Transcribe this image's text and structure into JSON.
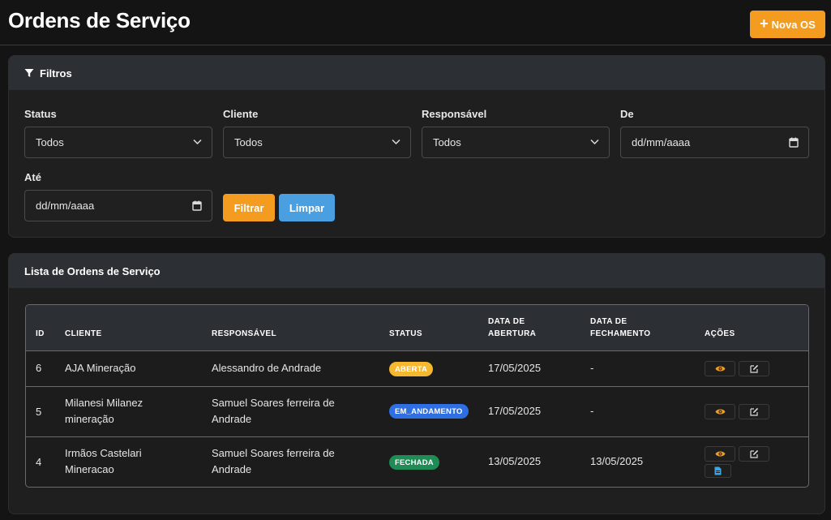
{
  "page": {
    "title": "Ordens de Serviço",
    "new_button_label": "Nova OS"
  },
  "filters": {
    "header": "Filtros",
    "status": {
      "label": "Status",
      "value": "Todos"
    },
    "cliente": {
      "label": "Cliente",
      "value": "Todos"
    },
    "responsavel": {
      "label": "Responsável",
      "value": "Todos"
    },
    "de": {
      "label": "De",
      "placeholder": "dd/mm/aaaa"
    },
    "ate": {
      "label": "Até",
      "placeholder": "dd/mm/aaaa"
    },
    "filter_button": "Filtrar",
    "clear_button": "Limpar"
  },
  "list": {
    "header": "Lista de Ordens de Serviço",
    "columns": {
      "id": "ID",
      "cliente": "CLIENTE",
      "responsavel": "RESPONSÁVEL",
      "status": "STATUS",
      "data_abertura_1": "DATA DE",
      "data_abertura_2": "ABERTURA",
      "data_fechamento_1": "DATA DE",
      "data_fechamento_2": "FECHAMENTO",
      "acoes": "AÇÕES"
    },
    "rows": [
      {
        "id": "6",
        "cliente_1": "AJA Mineração",
        "cliente_2": "",
        "responsavel_1": "Alessandro de Andrade",
        "responsavel_2": "",
        "status": "ABERTA",
        "status_color": "#f5b82e",
        "abertura": "17/05/2025",
        "fechamento": "-"
      },
      {
        "id": "5",
        "cliente_1": "Milanesi Milanez",
        "cliente_2": "mineração",
        "responsavel_1": "Samuel Soares ferreira de",
        "responsavel_2": "Andrade",
        "status": "EM_ANDAMENTO",
        "status_color": "#2f6fe4",
        "abertura": "17/05/2025",
        "fechamento": "-"
      },
      {
        "id": "4",
        "cliente_1": "Irmãos Castelari",
        "cliente_2": "Mineracao",
        "responsavel_1": "Samuel Soares ferreira de",
        "responsavel_2": "Andrade",
        "status": "FECHADA",
        "status_color": "#1f8b55",
        "abertura": "13/05/2025",
        "fechamento": "13/05/2025"
      }
    ]
  },
  "colors": {
    "accent": "#f39c1f",
    "secondary": "#4a9fe0",
    "background": "#141414",
    "card_header": "#2c2f33"
  },
  "icons": {
    "filter": "filter-icon",
    "plus": "plus-icon",
    "view": "eye-icon",
    "edit": "edit-icon",
    "document": "document-icon",
    "calendar": "calendar-icon",
    "chevron": "chevron-down-icon"
  }
}
